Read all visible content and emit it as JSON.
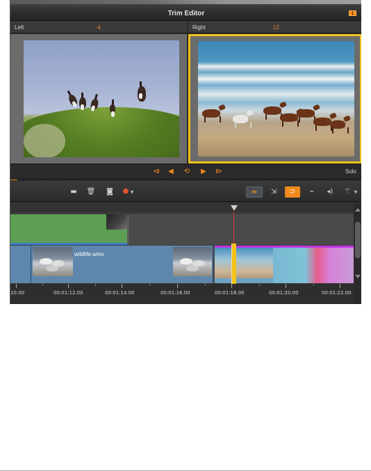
{
  "window": {
    "title": "Trim Editor",
    "layout_icon": "layout-toggle-icon"
  },
  "left_panel": {
    "label": "Left",
    "value": "-4"
  },
  "right_panel": {
    "label": "Right",
    "value": "12"
  },
  "playback": {
    "icons": [
      "go-to-start-icon",
      "step-back-icon",
      "loop-play-icon",
      "step-forward-icon",
      "go-to-end-icon"
    ],
    "solo_label": "Solo"
  },
  "toolbar": {
    "icons": [
      "storyboard-icon",
      "trash-icon",
      "snapshot-icon",
      "marker-icon",
      "trim-mode-icon",
      "razor-icon",
      "magnet-icon",
      "audio-scrub-icon",
      "speaker-icon",
      "wand-icon"
    ]
  },
  "timeline": {
    "clips": [
      {
        "name": "wildlife.wmv"
      }
    ],
    "timecodes": [
      "10.00",
      "00:01:12.00",
      "00:01:14.00",
      "00:01:16.00",
      "00:01:18.00",
      "00:01:20.00",
      "00:01:22.00"
    ]
  },
  "colors": {
    "accent": "#f08a1c",
    "selection": "#f2c21a",
    "playhead": "#e43333",
    "clip_selected_border": "#c034e4"
  }
}
